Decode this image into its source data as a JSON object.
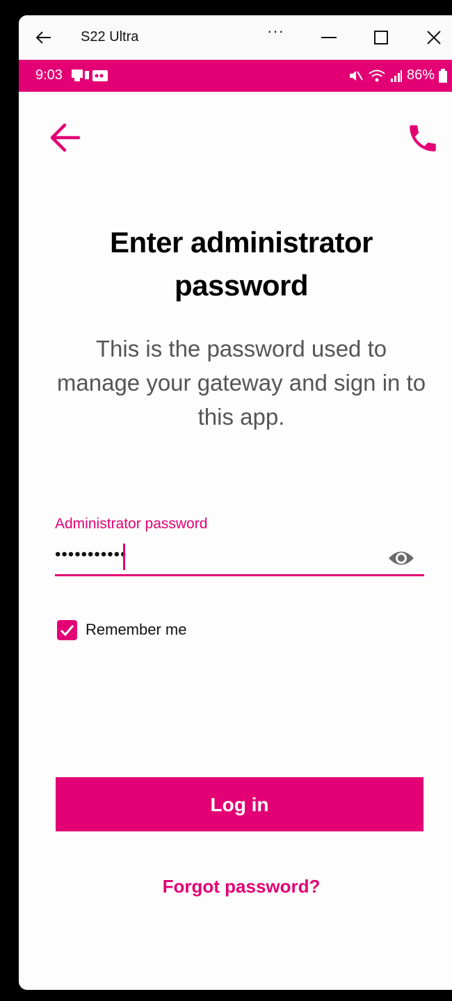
{
  "window": {
    "title": "S22 Ultra",
    "more": "···"
  },
  "status_bar": {
    "time": "9:03",
    "battery": "86%"
  },
  "page": {
    "title": "Enter administrator password",
    "subtitle": "This is the password used to manage your gateway and sign in to this app."
  },
  "password_field": {
    "label": "Administrator password",
    "value": "•••••••••••"
  },
  "remember": {
    "label": "Remember me",
    "checked": true
  },
  "buttons": {
    "login": "Log in",
    "forgot": "Forgot password?"
  },
  "colors": {
    "accent": "#e20074"
  }
}
